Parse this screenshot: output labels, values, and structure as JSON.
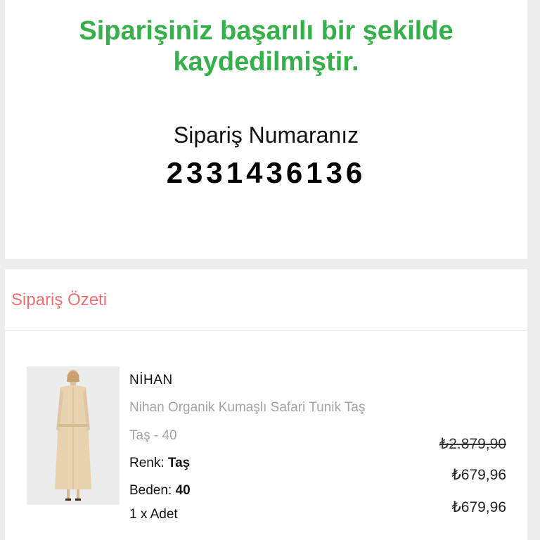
{
  "success": {
    "title": "Siparişiniz başarılı bir şekilde kaydedilmiştir.",
    "order_label": "Sipariş Numaranız",
    "order_number": "2331436136"
  },
  "summary": {
    "title": "Sipariş Özeti",
    "item": {
      "brand": "NİHAN",
      "name": "Nihan Organik Kumaşlı Safari Tunik Taş",
      "variant": "Taş - 40",
      "color_label": "Renk:",
      "color_value": "Taş",
      "size_label": "Beden:",
      "size_value": "40",
      "quantity": "1 x Adet",
      "price_original": "₺2.879,90",
      "price_discounted": "₺679,96",
      "price_total": "₺679,96"
    }
  },
  "colors": {
    "success": "#36b04a",
    "summary_title": "#ef6f73"
  }
}
